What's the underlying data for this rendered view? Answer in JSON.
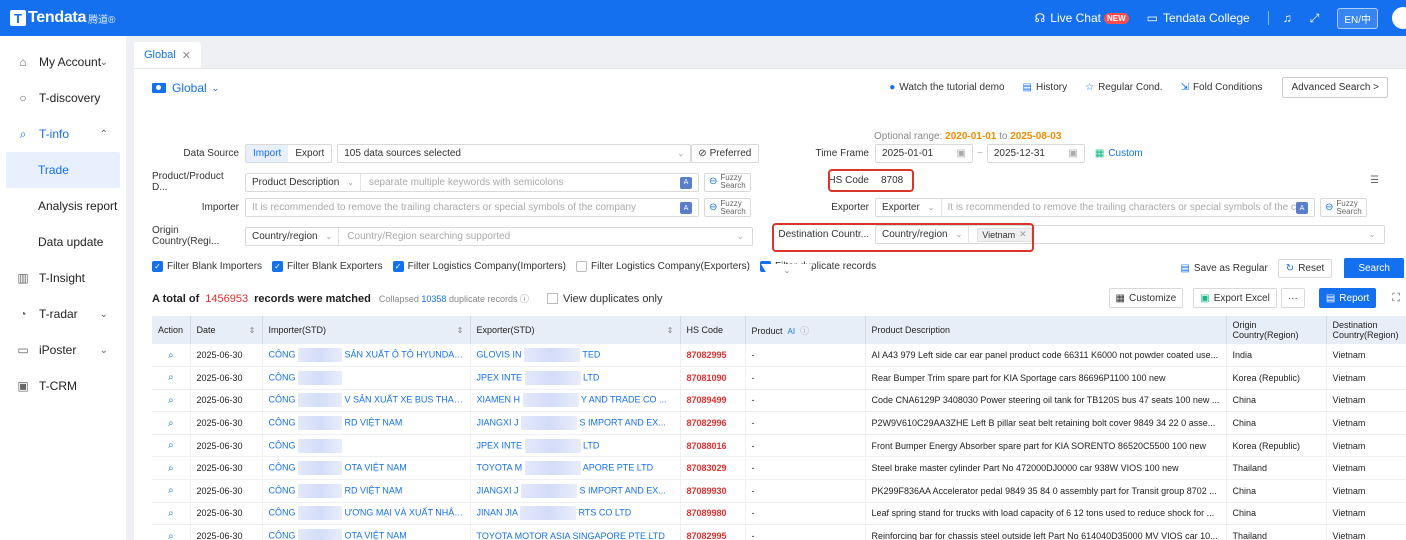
{
  "header": {
    "logo_text": "Tendata",
    "logo_sub": "腾道®",
    "live_chat": "Live Chat",
    "new_badge": "NEW",
    "college": "Tendata College",
    "lang": "EN/中"
  },
  "sidebar": {
    "items": [
      {
        "label": "My Account",
        "icon": "user-icon"
      },
      {
        "label": "T-discovery",
        "icon": "circle-icon"
      },
      {
        "label": "T-info",
        "icon": "search-icon"
      },
      {
        "label": "Trade"
      },
      {
        "label": "Analysis report"
      },
      {
        "label": "Data update"
      },
      {
        "label": "T-Insight",
        "icon": "bar-chart-icon"
      },
      {
        "label": "T-radar",
        "icon": "radar-icon"
      },
      {
        "label": "iPoster",
        "icon": "poster-icon"
      },
      {
        "label": "T-CRM",
        "icon": "crm-icon"
      }
    ]
  },
  "tabs": {
    "global": "Global"
  },
  "filters": {
    "title": "Global",
    "watch": "Watch the tutorial demo",
    "history": "History",
    "regular": "Regular Cond.",
    "fold": "Fold Conditions",
    "advanced": "Advanced Search >",
    "optional_prefix": "Optional range:",
    "optional_from": "2020-01-01",
    "optional_to_word": "to",
    "optional_to": "2025-08-03",
    "data_source_label": "Data Source",
    "import": "Import",
    "export": "Export",
    "sources": "105 data sources selected",
    "preferred": "Preferred",
    "time_frame_label": "Time Frame",
    "date_from": "2025-01-01",
    "date_to": "2025-12-31",
    "custom": "Custom",
    "product_label": "Product/Product D...",
    "product_select": "Product Description",
    "product_ph": "separate multiple keywords with semicolons",
    "fuzzy_1": "Fuzzy",
    "fuzzy_2": "Search",
    "hs_label": "HS Code",
    "hs_value": "8708",
    "importer_label": "Importer",
    "importer_ph": "It is recommended to remove the trailing characters or special symbols of the company",
    "exporter_label": "Exporter",
    "exporter_select": "Exporter",
    "exporter_ph": "It is recommended to remove the trailing characters or special symbols of the company",
    "origin_label": "Origin Country(Regi...",
    "origin_select": "Country/region",
    "origin_ph": "Country/Region searching supported",
    "dest_label": "Destination Countr...",
    "dest_select": "Country/region",
    "dest_tag": "Vietnam",
    "check_1": "Filter Blank Importers",
    "check_2": "Filter Blank Exporters",
    "check_3": "Filter Logistics Company(Importers)",
    "check_4": "Filter Logistics Company(Exporters)",
    "check_5": "Filter duplicate records",
    "save_regular": "Save as Regular",
    "reset": "Reset",
    "search": "Search"
  },
  "results": {
    "total_prefix": "A total of",
    "total": "1456953",
    "matched": "records were matched",
    "collapsed_word": "Collapsed",
    "collapsed": "10358",
    "dup_word": "duplicate records",
    "view_dup": "View duplicates only",
    "customize": "Customize",
    "export_excel": "Export Excel",
    "more": "···",
    "report": "Report",
    "columns": [
      "Action",
      "Date",
      "Importer(STD)",
      "Exporter(STD)",
      "HS Code",
      "Product",
      "Product Description",
      "Origin Country(Region)",
      "Destination Country(Region)"
    ],
    "product_ai": "AI",
    "rows": [
      {
        "date": "2025-06-30",
        "imp_a": "CÔNG",
        "imp_b": "SẢN XUẤT Ô TÔ HYUNDAI ...",
        "exp_a": "GLOVIS IN",
        "exp_b": "TED",
        "hs": "87082995",
        "prod": "-",
        "desc": "AI A43 979 Left side car ear panel product code 66311 K6000 not powder coated use...",
        "origin": "India",
        "dest": "Vietnam"
      },
      {
        "date": "2025-06-30",
        "imp_a": "CÔNG",
        "imp_b": "",
        "exp_a": "JPEX INTE",
        "exp_b": "LTD",
        "hs": "87081090",
        "prod": "-",
        "desc": "Rear Bumper Trim spare part for KIA Sportage cars 86696P1100 100 new",
        "origin": "Korea (Republic)",
        "dest": "Vietnam"
      },
      {
        "date": "2025-06-30",
        "imp_a": "CÔNG",
        "imp_b": "V SẢN XUẤT XE BUS THACO",
        "exp_a": "XIAMEN H",
        "exp_b": "Y AND TRADE CO ...",
        "hs": "87089499",
        "prod": "-",
        "desc": "Code CNA6129P 3408030 Power steering oil tank for TB120S bus 47 seats 100 new ...",
        "origin": "China",
        "dest": "Vietnam"
      },
      {
        "date": "2025-06-30",
        "imp_a": "CÔNG",
        "imp_b": "RD VIỆT NAM",
        "exp_a": "JIANGXI J",
        "exp_b": "S IMPORT AND EX...",
        "hs": "87082996",
        "prod": "-",
        "desc": "P2W9V610C29AA3ZHE Left B pillar seat belt retaining bolt cover 9849 34 22 0 asse...",
        "origin": "China",
        "dest": "Vietnam"
      },
      {
        "date": "2025-06-30",
        "imp_a": "CÔNG",
        "imp_b": "",
        "exp_a": "JPEX INTE",
        "exp_b": "LTD",
        "hs": "87088016",
        "prod": "-",
        "desc": "Front Bumper Energy Absorber spare part for KIA SORENTO 86520C5500 100 new",
        "origin": "Korea (Republic)",
        "dest": "Vietnam"
      },
      {
        "date": "2025-06-30",
        "imp_a": "CÔNG",
        "imp_b": "OTA VIỆT NAM",
        "exp_a": "TOYOTA M",
        "exp_b": "APORE PTE LTD",
        "hs": "87083029",
        "prod": "-",
        "desc": "Steel brake master cylinder Part No 472000DJ0000 car 938W VIOS 100 new",
        "origin": "Thailand",
        "dest": "Vietnam"
      },
      {
        "date": "2025-06-30",
        "imp_a": "CÔNG",
        "imp_b": "RD VIỆT NAM",
        "exp_a": "JIANGXI J",
        "exp_b": "S IMPORT AND EX...",
        "hs": "87089930",
        "prod": "-",
        "desc": "PK299F836AA Accelerator pedal 9849 35 84 0 assembly part for Transit group 8702 ...",
        "origin": "China",
        "dest": "Vietnam"
      },
      {
        "date": "2025-06-30",
        "imp_a": "CÔNG",
        "imp_b": "ƯƠNG MẠI VÀ XUẤT NHẬP ...",
        "exp_a": "JINAN JIA",
        "exp_b": "RTS CO LTD",
        "hs": "87089980",
        "prod": "-",
        "desc": "Leaf spring stand for trucks with load capacity of 6 12 tons used to reduce shock for ...",
        "origin": "China",
        "dest": "Vietnam"
      },
      {
        "date": "2025-06-30",
        "imp_a": "CÔNG",
        "imp_b": "OTA VIỆT NAM",
        "exp_a": "TOYOTA MOTOR ASIA SINGAPORE PTE LTD",
        "exp_b": "",
        "hs": "87082995",
        "prod": "-",
        "desc": "Reinforcing bar for chassis steel outside left Part No 614040D35000 MV VIOS car 10...",
        "origin": "Thailand",
        "dest": "Vietnam"
      }
    ]
  }
}
